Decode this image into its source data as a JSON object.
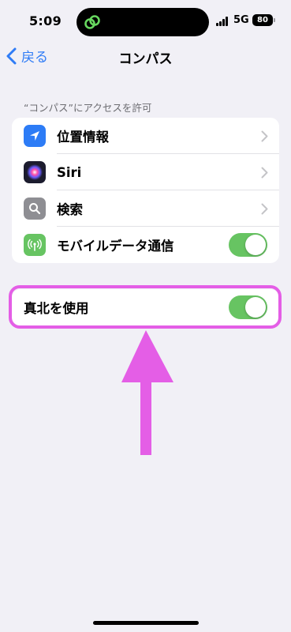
{
  "status_bar": {
    "time": "5:09",
    "network": "5G",
    "battery": "80"
  },
  "nav": {
    "back_label": "戻る",
    "title": "コンパス"
  },
  "section_header": "“コンパス”にアクセスを許可",
  "access_items": [
    {
      "label": "位置情報",
      "icon": "location-arrow-icon",
      "icon_color": "#2d7cf6",
      "control": "chevron"
    },
    {
      "label": "Siri",
      "icon": "siri-icon",
      "icon_color": "#1c1c2e",
      "control": "chevron"
    },
    {
      "label": "検索",
      "icon": "search-icon",
      "icon_color": "#8e8e93",
      "control": "chevron"
    },
    {
      "label": "モバイルデータ通信",
      "icon": "cellular-antenna-icon",
      "icon_color": "#67c462",
      "control": "toggle",
      "toggle_on": true
    }
  ],
  "true_north": {
    "label": "真北を使用",
    "toggle_on": true
  },
  "colors": {
    "accent": "#2f7cf6",
    "toggle_on": "#67c462",
    "highlight": "#e45ee6",
    "background": "#f1f0f6"
  }
}
